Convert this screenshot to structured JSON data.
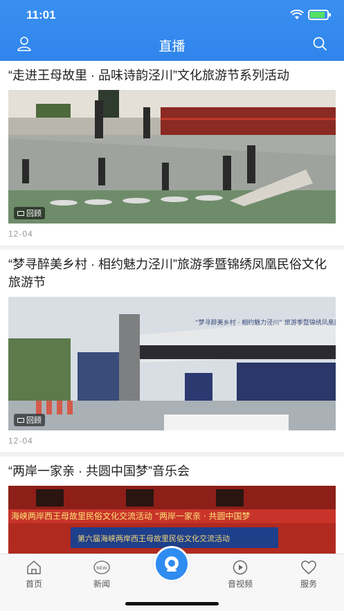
{
  "status_bar": {
    "time": "11:01"
  },
  "header": {
    "title": "直播"
  },
  "feed": [
    {
      "title": "“走进王母故里 · 品味诗韵泾川”文化旅游节系列活动",
      "badge": "回顾",
      "date": "12-04"
    },
    {
      "title": "“梦寻醉美乡村 · 相约魅力泾川”旅游季暨锦绣凤凰民俗文化旅游节",
      "badge": "回顾",
      "date": "12-04",
      "banner_text": "“梦寻醉美乡村 · 相约魅力泾川” 旅游季暨锦绣凤凰民俗文化旅游节"
    },
    {
      "title": "“两岸一家亲 · 共圆中国梦”音乐会",
      "banner_text_1": "海峡两岸西王母故里民俗文化交流活动 “两岸一家亲 · 共圆中国梦",
      "banner_text_2": "第六届海峡两岸西王母故里民俗文化交流活动"
    }
  ],
  "tabbar": {
    "items": [
      {
        "label": "首页"
      },
      {
        "label": "新闻",
        "icon_text": "NEW"
      },
      {
        "label": "音视频"
      },
      {
        "label": "服务"
      }
    ]
  },
  "colors": {
    "primary": "#2f85ec",
    "battery": "#55e065"
  }
}
